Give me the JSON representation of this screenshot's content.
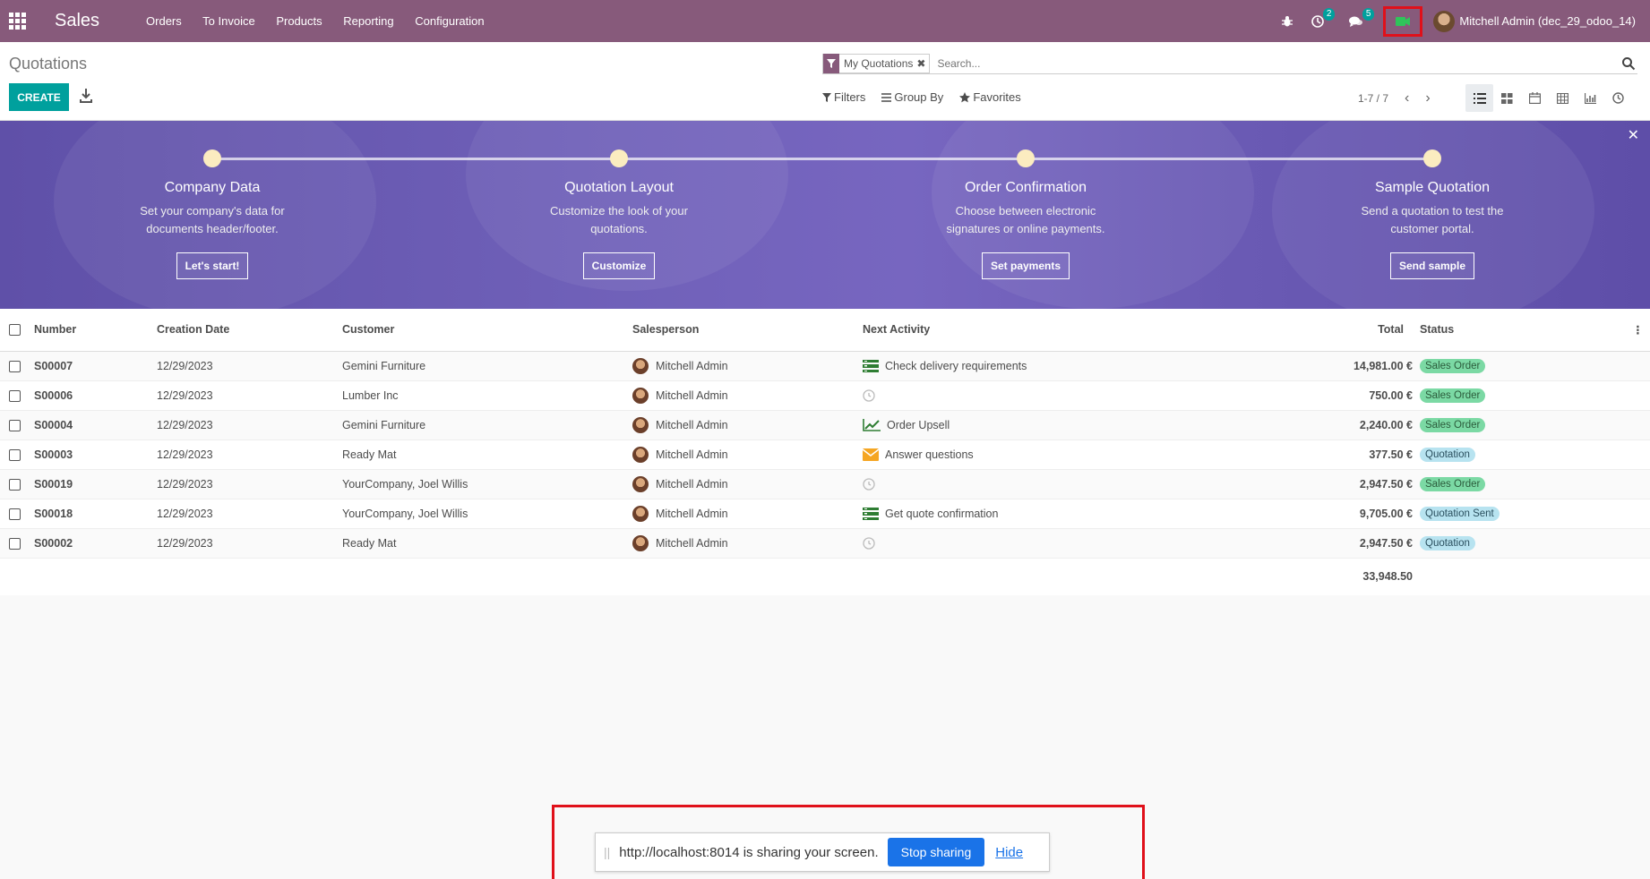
{
  "navbar": {
    "app_name": "Sales",
    "menu": [
      "Orders",
      "To Invoice",
      "Products",
      "Reporting",
      "Configuration"
    ],
    "activity_count": "2",
    "messages_count": "5",
    "user": "Mitchell Admin (dec_29_odoo_14)"
  },
  "control": {
    "title": "Quotations",
    "create_label": "CREATE",
    "facet_label": "My Quotations",
    "search_placeholder": "Search...",
    "filters_label": "Filters",
    "groupby_label": "Group By",
    "favorites_label": "Favorites",
    "pager": "1-7 / 7"
  },
  "banner": {
    "steps": [
      {
        "title": "Company Data",
        "desc": "Set your company's data for documents header/footer.",
        "button": "Let's start!"
      },
      {
        "title": "Quotation Layout",
        "desc": "Customize the look of your quotations.",
        "button": "Customize"
      },
      {
        "title": "Order Confirmation",
        "desc": "Choose between electronic signatures or online payments.",
        "button": "Set payments"
      },
      {
        "title": "Sample Quotation",
        "desc": "Send a quotation to test the customer portal.",
        "button": "Send sample"
      }
    ]
  },
  "table": {
    "headers": {
      "number": "Number",
      "date": "Creation Date",
      "customer": "Customer",
      "salesperson": "Salesperson",
      "activity": "Next Activity",
      "total": "Total",
      "status": "Status"
    },
    "rows": [
      {
        "number": "S00007",
        "date": "12/29/2023",
        "customer": "Gemini Furniture",
        "salesperson": "Mitchell Admin",
        "activity": "Check delivery requirements",
        "activity_icon": "tasks-icon",
        "total": "14,981.00 €",
        "status": "Sales Order"
      },
      {
        "number": "S00006",
        "date": "12/29/2023",
        "customer": "Lumber Inc",
        "salesperson": "Mitchell Admin",
        "activity": "",
        "activity_icon": "clock-icon",
        "total": "750.00 €",
        "status": "Sales Order"
      },
      {
        "number": "S00004",
        "date": "12/29/2023",
        "customer": "Gemini Furniture",
        "salesperson": "Mitchell Admin",
        "activity": "Order Upsell",
        "activity_icon": "chart-line-icon",
        "total": "2,240.00 €",
        "status": "Sales Order"
      },
      {
        "number": "S00003",
        "date": "12/29/2023",
        "customer": "Ready Mat",
        "salesperson": "Mitchell Admin",
        "activity": "Answer questions",
        "activity_icon": "envelope-icon",
        "total": "377.50 €",
        "status": "Quotation"
      },
      {
        "number": "S00019",
        "date": "12/29/2023",
        "customer": "YourCompany, Joel Willis",
        "salesperson": "Mitchell Admin",
        "activity": "",
        "activity_icon": "clock-icon",
        "total": "2,947.50 €",
        "status": "Sales Order"
      },
      {
        "number": "S00018",
        "date": "12/29/2023",
        "customer": "YourCompany, Joel Willis",
        "salesperson": "Mitchell Admin",
        "activity": "Get quote confirmation",
        "activity_icon": "tasks-icon",
        "total": "9,705.00 €",
        "status": "Quotation Sent"
      },
      {
        "number": "S00002",
        "date": "12/29/2023",
        "customer": "Ready Mat",
        "salesperson": "Mitchell Admin",
        "activity": "",
        "activity_icon": "clock-icon",
        "total": "2,947.50 €",
        "status": "Quotation"
      }
    ],
    "sum_total": "33,948.50"
  },
  "share": {
    "message": "http://localhost:8014 is sharing your screen.",
    "stop_label": "Stop sharing",
    "hide_label": "Hide"
  },
  "colors": {
    "brand": "#875a7b",
    "accent": "#00a09d",
    "banner": "#6f60b8",
    "highlight": "#e0101a"
  }
}
